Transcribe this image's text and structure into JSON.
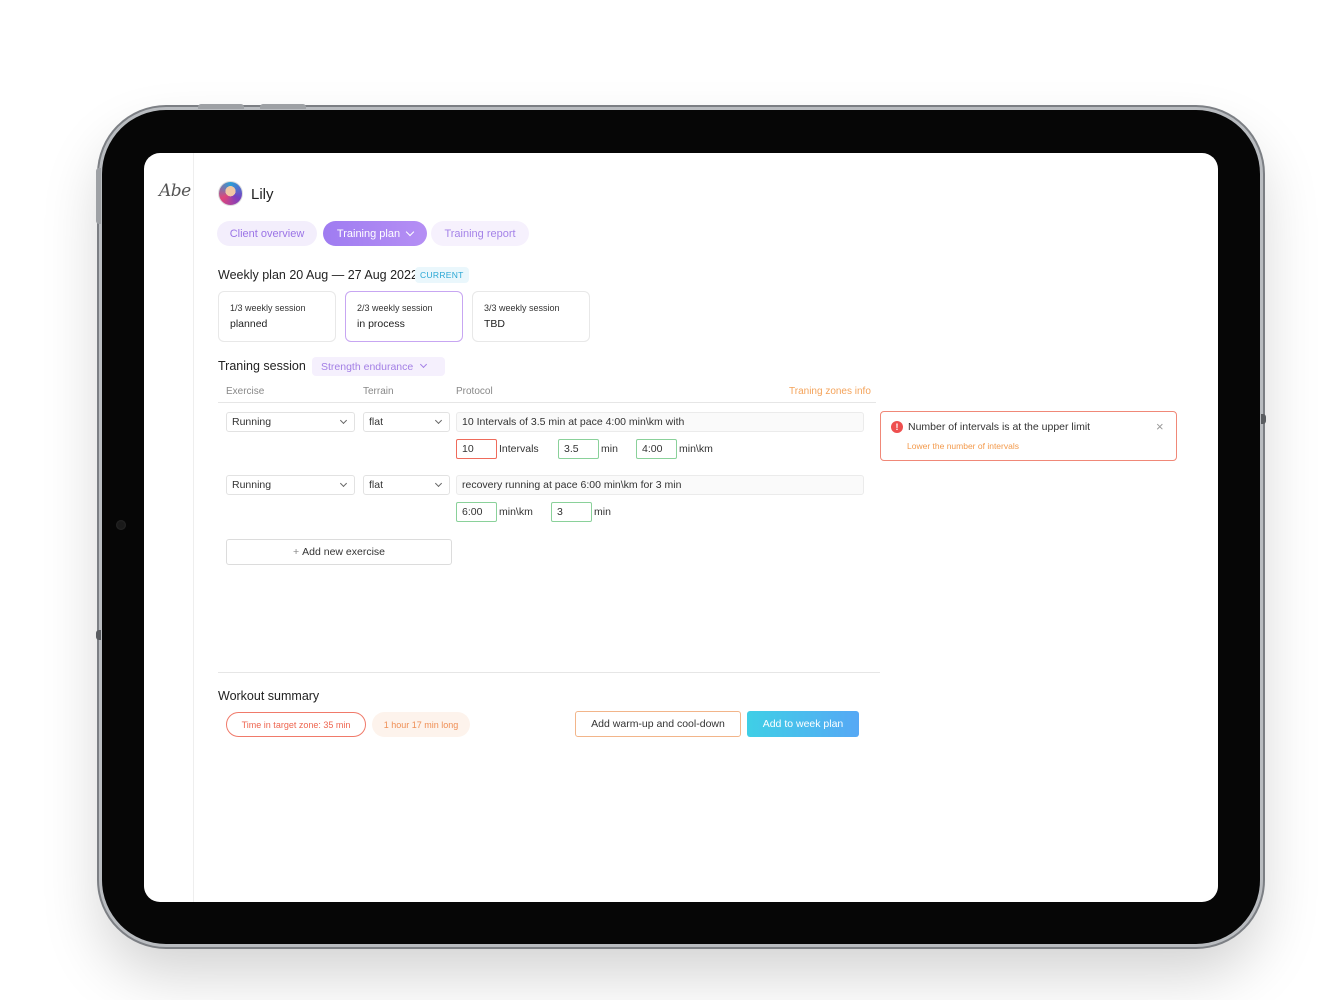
{
  "app": {
    "logo_text": "Abe"
  },
  "client": {
    "name": "Lily"
  },
  "tabs": [
    {
      "label": "Client overview",
      "active": false
    },
    {
      "label": "Training plan",
      "active": true
    },
    {
      "label": "Training report",
      "active": false
    }
  ],
  "week": {
    "title": "Weekly plan 20 Aug — 27 Aug 2022",
    "badge": "CURRENT",
    "sessions": [
      {
        "label": "1/3 weekly session",
        "status": "planned"
      },
      {
        "label": "2/3 weekly session",
        "status": "in process"
      },
      {
        "label": "3/3 weekly session",
        "status": "TBD"
      }
    ]
  },
  "training": {
    "label": "Traning session",
    "type": "Strength endurance",
    "columns": {
      "exercise": "Exercise",
      "terrain": "Terrain",
      "protocol": "Protocol"
    },
    "zones_link": "Traning zones info",
    "rows": [
      {
        "exercise": "Running",
        "terrain": "flat",
        "protocol": "10 Intervals of 3.5 min at pace 4:00 min\\km with",
        "fields": [
          {
            "value": "10",
            "unit": "Intervals",
            "state": "error"
          },
          {
            "value": "3.5",
            "unit": "min",
            "state": "ok"
          },
          {
            "value": "4:00",
            "unit": "min\\km",
            "state": "ok"
          }
        ]
      },
      {
        "exercise": "Running",
        "terrain": "flat",
        "protocol": "recovery running at pace 6:00 min\\km for 3 min",
        "fields": [
          {
            "value": "6:00",
            "unit": "min\\km",
            "state": "ok"
          },
          {
            "value": "3",
            "unit": "min",
            "state": "ok"
          }
        ]
      }
    ],
    "add_label": "Add new exercise"
  },
  "alert": {
    "title": "Number of intervals is at the upper limit",
    "subtitle": "Lower the number of intervals",
    "icon": "error-icon"
  },
  "summary": {
    "title": "Workout summary",
    "target_zone": "Time in target zone: 35 min",
    "duration": "1 hour 17 min long",
    "warmup_label": "Add warm-up and cool-down",
    "add_week_label": "Add to week plan"
  },
  "colors": {
    "accent_purple": "#a583e8",
    "accent_blue": "#3fcfe6",
    "error": "#ef6b5b",
    "ok": "#8ad19a",
    "warning": "#f39a4c"
  }
}
